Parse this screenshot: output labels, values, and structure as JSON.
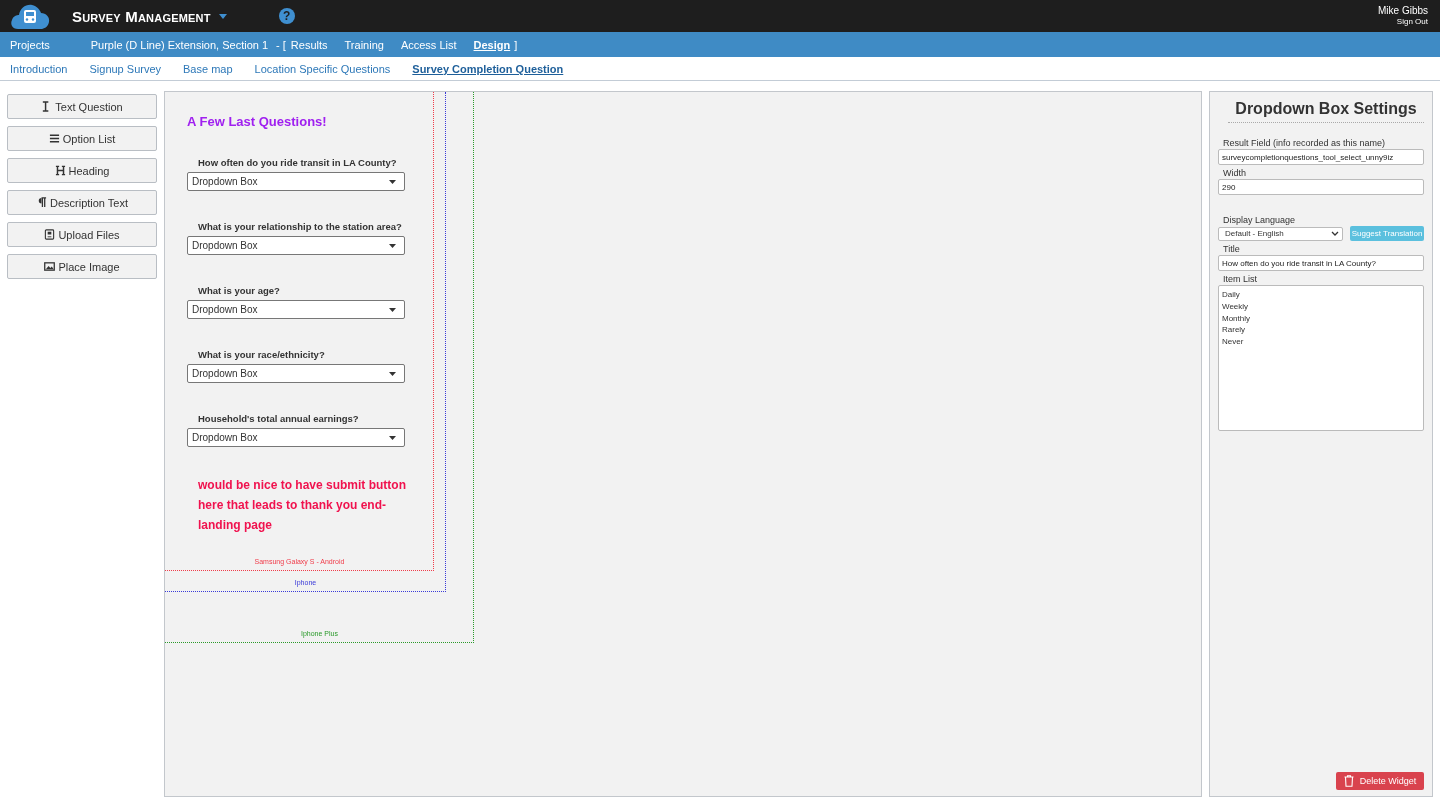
{
  "header": {
    "app_title": "Survey Management",
    "user_name": "Mike Gibbs",
    "sign_out": "Sign Out",
    "help": "?"
  },
  "nav": {
    "projects": "Projects",
    "project_name": "Purple (D Line) Extension, Section 1",
    "bracket_open": "-  [",
    "tabs": [
      {
        "label": "Results",
        "selected": false
      },
      {
        "label": "Training",
        "selected": false
      },
      {
        "label": "Access List",
        "selected": false
      },
      {
        "label": "Design",
        "selected": true
      }
    ],
    "bracket_close": "]"
  },
  "sub_tabs": [
    {
      "label": "Introduction",
      "selected": false
    },
    {
      "label": "Signup Survey",
      "selected": false
    },
    {
      "label": "Base map",
      "selected": false
    },
    {
      "label": "Location Specific Questions",
      "selected": false
    },
    {
      "label": "Survey Completion Question",
      "selected": true
    }
  ],
  "tools": [
    {
      "label": "Text Question",
      "kind": "text"
    },
    {
      "label": "Option List",
      "kind": "list"
    },
    {
      "label": "Heading",
      "kind": "heading"
    },
    {
      "label": "Description Text",
      "kind": "paragraph"
    },
    {
      "label": "Upload Files",
      "kind": "upload"
    },
    {
      "label": "Place Image",
      "kind": "image"
    }
  ],
  "canvas": {
    "title": "A Few Last Questions!",
    "questions": [
      {
        "label": "How often do you ride transit in LA County?",
        "value": "Dropdown Box"
      },
      {
        "label": "What is your relationship to the station area?",
        "value": "Dropdown Box"
      },
      {
        "label": "What is your age?",
        "value": "Dropdown Box"
      },
      {
        "label": "What is your race/ethnicity?",
        "value": "Dropdown Box"
      },
      {
        "label": "Household's total annual earnings?",
        "value": "Dropdown Box"
      }
    ],
    "note": "would be nice to have submit button here that leads to thank you end-landing page",
    "devices": [
      {
        "label": "Samsung Galaxy S - Android",
        "color": "#f03c4a"
      },
      {
        "label": "Iphone",
        "color": "#3a3ad8"
      },
      {
        "label": "Iphone Plus",
        "color": "#2a9a2a"
      }
    ]
  },
  "settings": {
    "title": "Dropdown Box Settings",
    "result_field_label": "Result Field (info recorded as this name)",
    "result_field_value": "surveycompletionquestions_tool_select_unny9iz",
    "width_label": "Width",
    "width_value": "290",
    "language_label": "Display Language",
    "language_value": "Default - English",
    "suggest_button": "Suggest Translation",
    "title_label": "Title",
    "title_value": "How often do you ride transit in LA County?",
    "item_list_label": "Item List",
    "items": [
      "Daily",
      "Weekly",
      "Monthly",
      "Rarely",
      "Never"
    ],
    "delete_button": "Delete Widget"
  }
}
